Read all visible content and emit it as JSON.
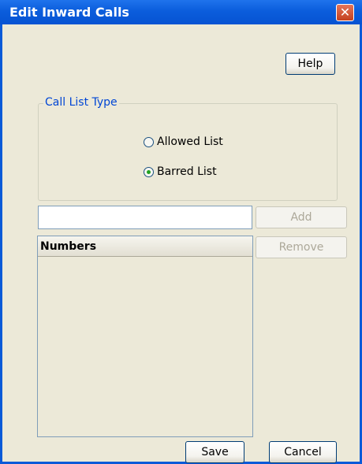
{
  "window": {
    "title": "Edit Inward Calls"
  },
  "toolbar": {
    "help_label": "Help"
  },
  "call_list_type": {
    "legend": "Call List Type",
    "options": [
      {
        "label": "Allowed List",
        "selected": false
      },
      {
        "label": "Barred List",
        "selected": true
      }
    ]
  },
  "numbers": {
    "input_value": "",
    "add_label": "Add",
    "remove_label": "Remove",
    "column_header": "Numbers",
    "rows": []
  },
  "footer": {
    "save_label": "Save",
    "cancel_label": "Cancel"
  },
  "colors": {
    "title_bar": "#0b5ddc",
    "dialog_bg": "#ece9d8",
    "group_label": "#0046d5",
    "radio_selected": "#21a121"
  },
  "icons": {
    "close": "close-icon"
  }
}
